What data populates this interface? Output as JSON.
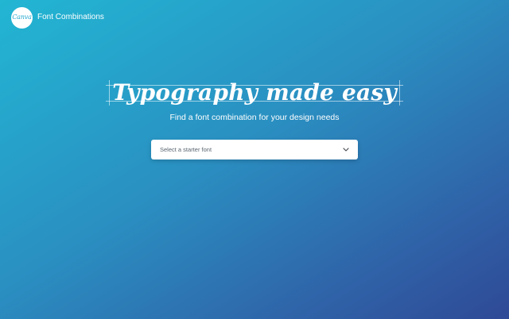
{
  "header": {
    "logo_text": "Canva",
    "title": "Font Combinations"
  },
  "hero": {
    "headline": "Typography made easy",
    "subheadline": "Find a font combination for your design needs"
  },
  "font_select": {
    "placeholder": "Select a starter font",
    "icon": "chevron-down-icon"
  },
  "colors": {
    "gradient_start": "#22b6d3",
    "gradient_end": "#2f4996",
    "logo_text": "#25a9cf",
    "placeholder_text": "#5a6570"
  }
}
